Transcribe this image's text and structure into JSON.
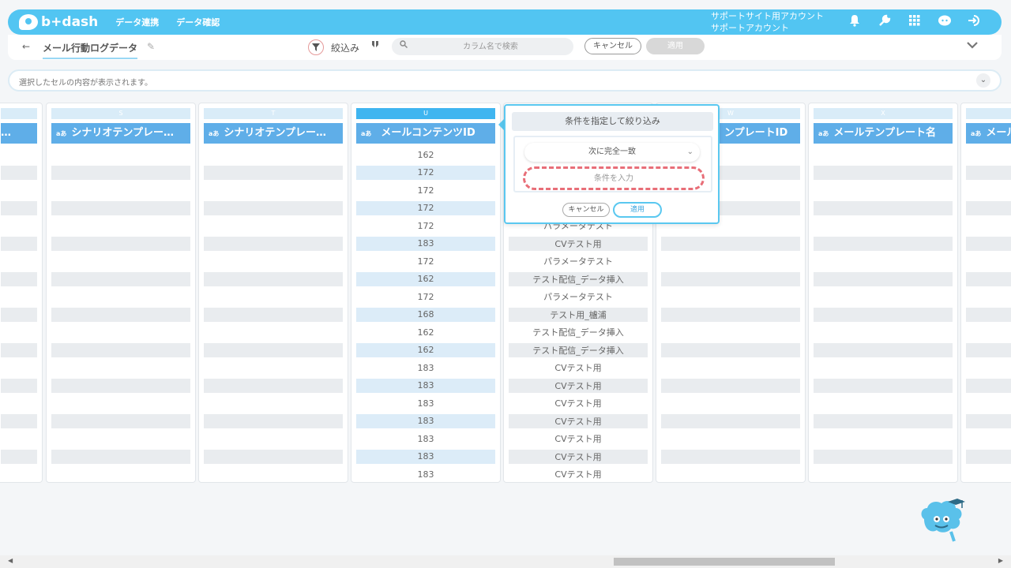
{
  "app": {
    "logo_text": "b+dash",
    "nav": [
      "データ連携",
      "データ確認"
    ],
    "account_line1": "サポートサイト用アカウント",
    "account_line2": "サポートアカウント"
  },
  "subbar": {
    "back_icon": "←",
    "page_title": "メール行動ログデータ",
    "filter_label": "絞込み",
    "search_placeholder": "カラム名で検索",
    "cancel_label": "キャンセル",
    "apply_label": "適用"
  },
  "cellbar": {
    "placeholder_text": "選択したセルの内容が表示されます。"
  },
  "columns": {
    "r": {
      "letter": "",
      "header": "…"
    },
    "s": {
      "letter": "S",
      "header": "シナリオテンプレー…"
    },
    "t": {
      "letter": "T",
      "header": "シナリオテンプレー…"
    },
    "u": {
      "letter": "U",
      "header": "メールコンテンツID",
      "values": [
        "162",
        "172",
        "172",
        "172",
        "172",
        "183",
        "172",
        "162",
        "172",
        "168",
        "162",
        "162",
        "183",
        "183",
        "183",
        "183",
        "183",
        "183",
        "183"
      ]
    },
    "v": {
      "values": [
        "",
        "",
        "",
        "",
        "パラメータテスト",
        "CVテスト用",
        "パラメータテスト",
        "テスト配信_データ挿入",
        "パラメータテスト",
        "テスト用_櫨浦",
        "テスト配信_データ挿入",
        "テスト配信_データ挿入",
        "CVテスト用",
        "CVテスト用",
        "CVテスト用",
        "CVテスト用",
        "CVテスト用",
        "CVテスト用",
        "CVテスト用"
      ]
    },
    "w": {
      "letter": "W",
      "header": "ンプレートID"
    },
    "x": {
      "letter": "X",
      "header": "メールテンプレート名"
    },
    "y": {
      "letter": "",
      "header": "メール"
    }
  },
  "popup": {
    "title": "条件を指定して絞り込み",
    "select_value": "次に完全一致",
    "input_placeholder": "条件を入力",
    "cancel_label": "キャンセル",
    "apply_label": "適用"
  },
  "colors": {
    "brand": "#52c5f2",
    "header_blue": "#5faee8",
    "highlight_dashed": "#e86e78"
  }
}
